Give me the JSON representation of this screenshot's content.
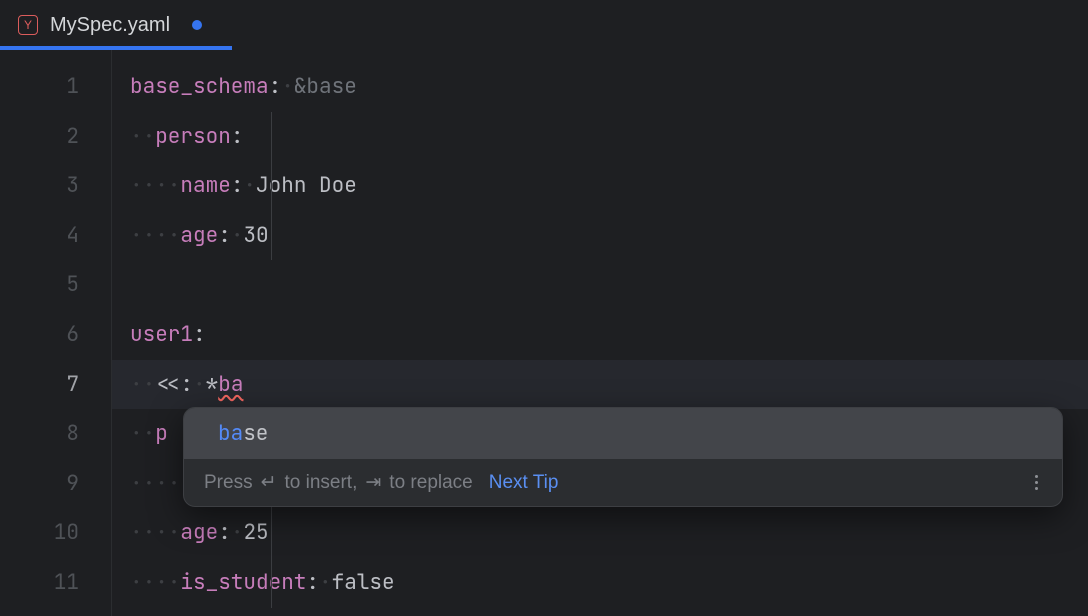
{
  "tab": {
    "filename": "MySpec.yaml",
    "icon_letter": "Y",
    "dirty": true
  },
  "gutter": {
    "lines": [
      "1",
      "2",
      "3",
      "4",
      "5",
      "6",
      "7",
      "8",
      "9",
      "10",
      "11"
    ],
    "current": 7
  },
  "code": {
    "l1": {
      "key": "base_schema",
      "anchor": "&base"
    },
    "l2": {
      "key": "person"
    },
    "l3": {
      "key": "name",
      "val": "John Doe"
    },
    "l4": {
      "key": "age",
      "val": "30"
    },
    "l6": {
      "key": "user1"
    },
    "l7": {
      "merge": "<<",
      "alias_prefix": "*",
      "typed": "ba"
    },
    "l8": {
      "key_partial": "p"
    },
    "l10": {
      "key": "age",
      "val": "25"
    },
    "l11": {
      "key": "is_student",
      "val": "false"
    }
  },
  "whitespace": {
    "dot": "·",
    "two": "··",
    "four": "····"
  },
  "popup": {
    "suggestion_match": "ba",
    "suggestion_rest": "se",
    "hint_prefix": "Press ",
    "hint_insert": " to insert, ",
    "hint_replace": " to replace",
    "enter_glyph": "↵",
    "tab_glyph": "⇥",
    "next_tip": "Next Tip"
  }
}
